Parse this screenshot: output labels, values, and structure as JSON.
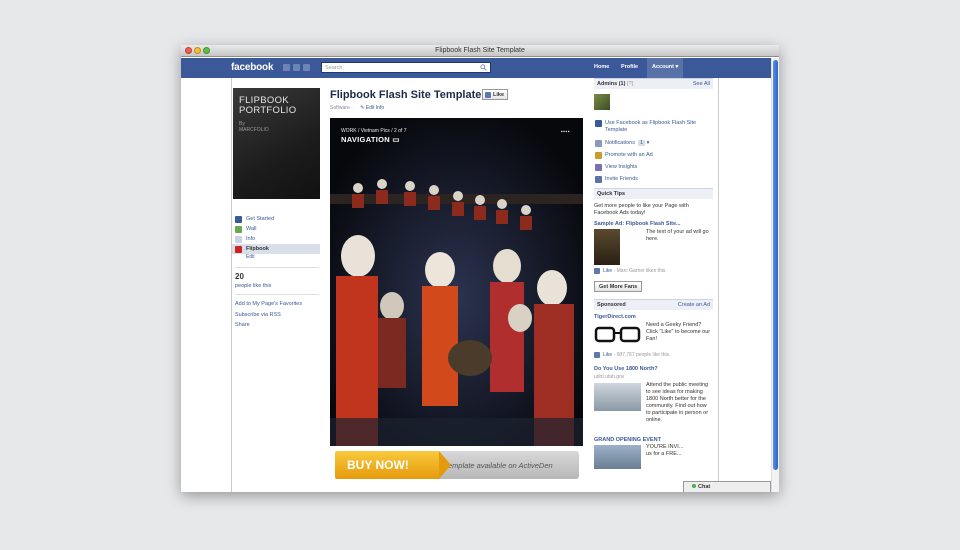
{
  "window": {
    "title": "Flipbook Flash Site Template"
  },
  "topbar": {
    "logo": "facebook",
    "search_placeholder": "Search",
    "links": [
      "Home",
      "Profile",
      "Account ▾"
    ]
  },
  "left": {
    "profile_title": "FLIPBOOK PORTFOLIO",
    "profile_by": "By",
    "profile_author": "MARCFOLIO",
    "nav": [
      {
        "label": "Get Started",
        "icon": "facebook-icon"
      },
      {
        "label": "Wall",
        "icon": "wall-icon"
      },
      {
        "label": "Info",
        "icon": "info-icon"
      },
      {
        "label": "Flipbook",
        "icon": "flipbook-icon",
        "selected": true
      }
    ],
    "edit": "Edit",
    "likes_count": "20",
    "likes_label": "people like this",
    "links": [
      "Add to My Page's Favorites",
      "Subscribe via RSS",
      "Share"
    ]
  },
  "main": {
    "title": "Flipbook Flash Site Template",
    "like_button": "Like",
    "category": "Software ·",
    "edit_info": "Edit Info",
    "photo_crumbs": "WORK / Vietnam Pics / 2 of 7",
    "photo_nav": "NAVIGATION",
    "buy_now": "BUY NOW!",
    "template_text": "Template available on ActiveDen"
  },
  "right": {
    "admins_label": "Admins (1)",
    "admins_help": "[?]",
    "see_all": "See All",
    "admin_links": [
      {
        "label": "Use Facebook as Flipbook Flash Site Template",
        "icon": "facebook-icon"
      },
      {
        "label": "Notifications",
        "badge": "1",
        "icon": "notifications-icon"
      },
      {
        "label": "Promote with an Ad",
        "icon": "megaphone-icon"
      },
      {
        "label": "View Insights",
        "icon": "insights-icon"
      },
      {
        "label": "Invite Friends",
        "icon": "friends-icon"
      }
    ],
    "quick_tips_label": "Quick Tips",
    "quick_tips_text": "Get more people to like your Page with Facebook Ads today!",
    "sample_ad_title": "Sample Ad: Flipbook Flash Site...",
    "sample_ad_text": "The text of your ad will go here.",
    "sample_ad_like": "Like",
    "sample_ad_like_text": " · Marc Garner likes this.",
    "get_more_fans": "Get More Fans",
    "sponsored_label": "Sponsored",
    "create_ad": "Create an Ad",
    "ads": [
      {
        "title": "TigerDirect.com",
        "text": "Need a Geeky Friend? Click \"Like\" to become our Fan!",
        "like": "Like",
        "like_text": " · 687,767 people like this."
      },
      {
        "title": "Do You Use 1800 North?",
        "url": "udot.utah.gov",
        "text": "Attend the public meeting to see ideas for making 1800 North better for the community. Find out how to participate in person or online."
      },
      {
        "title": "GRAND OPENING EVENT",
        "text": "YOU'RE INVI... us for a FRE..."
      }
    ]
  },
  "chat": {
    "label": "Chat"
  },
  "colors": {
    "facebook_blue": "#3b5998",
    "buy_orange": "#f0b020",
    "link": "#3b5998"
  }
}
